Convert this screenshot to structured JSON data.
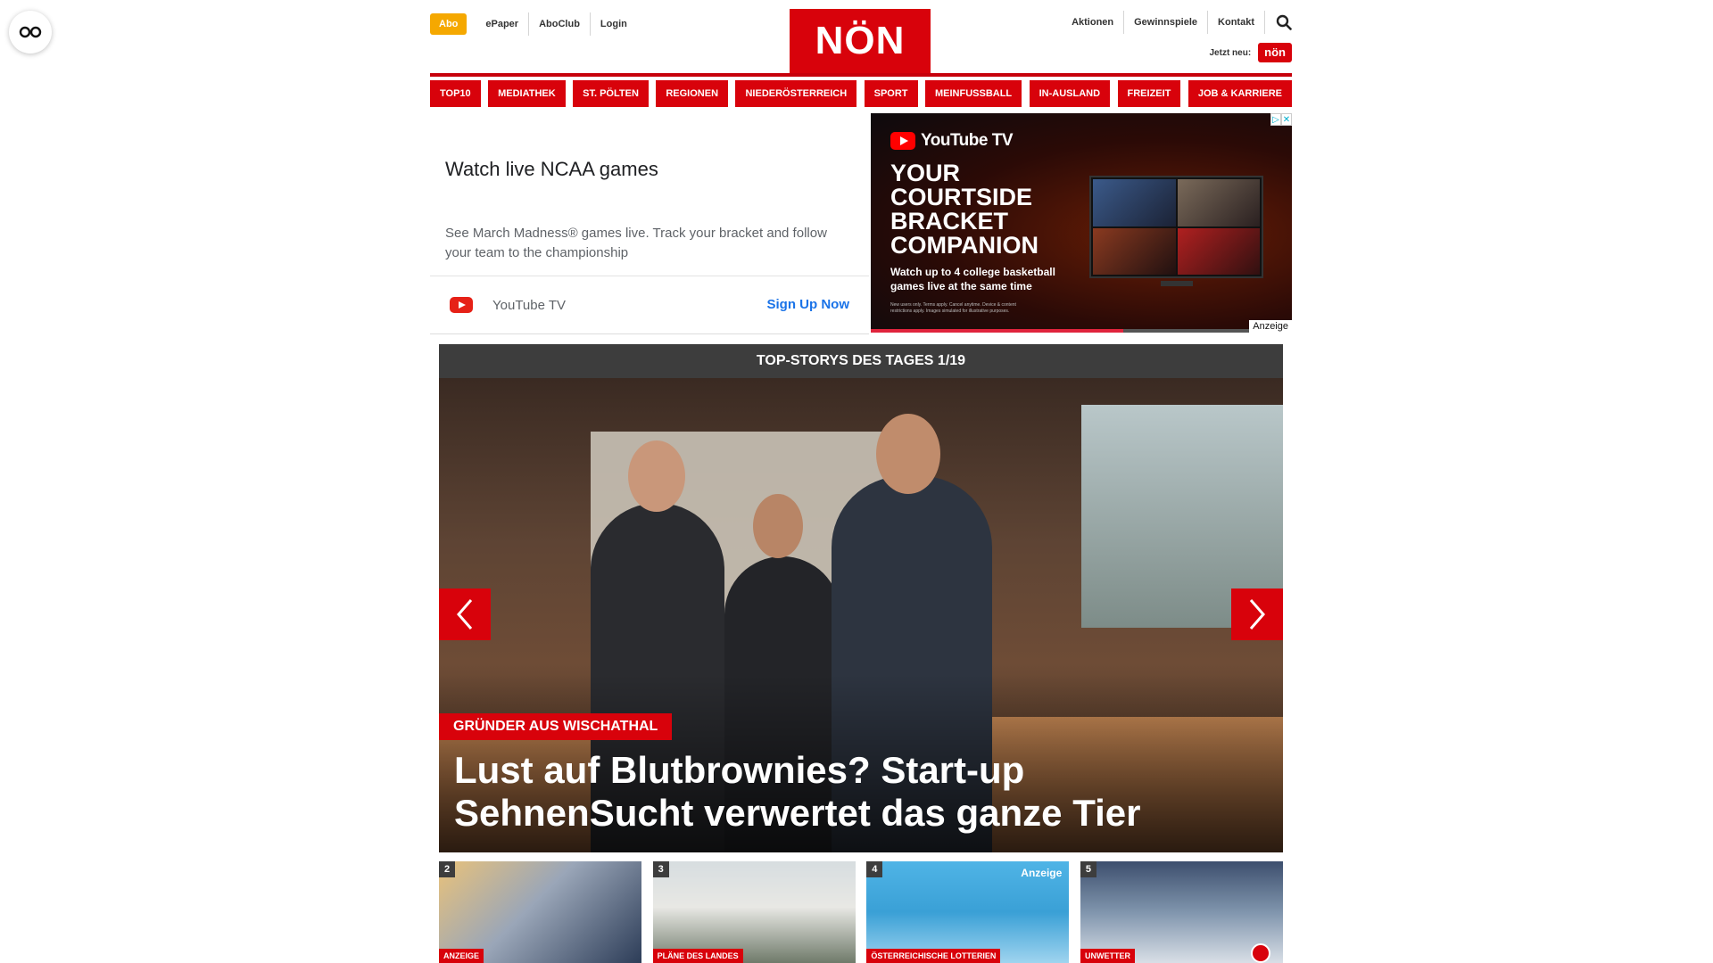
{
  "header": {
    "abo_label": "Abo",
    "left_links": [
      "ePaper",
      "AboClub",
      "Login"
    ],
    "logo_text": "NÖN",
    "right_links": [
      "Aktionen",
      "Gewinnspiele",
      "Kontakt"
    ],
    "jetzt_label": "Jetzt neu:",
    "jetzt_badge": "nön"
  },
  "nav": {
    "items": [
      "TOP10",
      "MEDIATHEK",
      "ST. PÖLTEN",
      "REGIONEN",
      "NIEDERÖSTERREICH",
      "SPORT",
      "MEINFUSSBALL",
      "IN-AUSLAND",
      "FREIZEIT",
      "JOB & KARRIERE"
    ]
  },
  "ad": {
    "title": "Watch live NCAA games",
    "text": "See March Madness® games live. Track your bracket and follow your team to the championship",
    "brand": "YouTube TV",
    "cta": "Sign Up Now",
    "banner_brand": "YouTube TV",
    "banner_headline": "YOUR COURTSIDE BRACKET COMPANION",
    "banner_sub": "Watch up to 4 college basketball games live at the same time",
    "banner_fine": "New users only. Terms apply. Cancel anytime. Device & content restrictions apply. Images simulated for illustrative purposes.",
    "label": "Anzeige",
    "progress": 0.6,
    "accent_color": "#e0243c"
  },
  "top_stories": {
    "heading": "TOP-STORYS DES TAGES 1/19",
    "hero": {
      "kicker": "GRÜNDER AUS WISCHATHAL",
      "title": "Lust auf Blutbrownies? Start-up SehnenSucht verwertet das ganze Tier"
    },
    "thumbs": [
      {
        "num": "2",
        "tag": "ANZEIGE",
        "anzeige": ""
      },
      {
        "num": "3",
        "tag": "PLÄNE DES LANDES",
        "anzeige": ""
      },
      {
        "num": "4",
        "tag": "ÖSTERREICHISCHE LOTTERIEN",
        "anzeige": "Anzeige"
      },
      {
        "num": "5",
        "tag": "UNWETTER",
        "anzeige": ""
      }
    ]
  },
  "colors": {
    "brand_red": "#d8020b",
    "abo_yellow": "#f5a800",
    "dark_bar": "#3d3d3d"
  }
}
